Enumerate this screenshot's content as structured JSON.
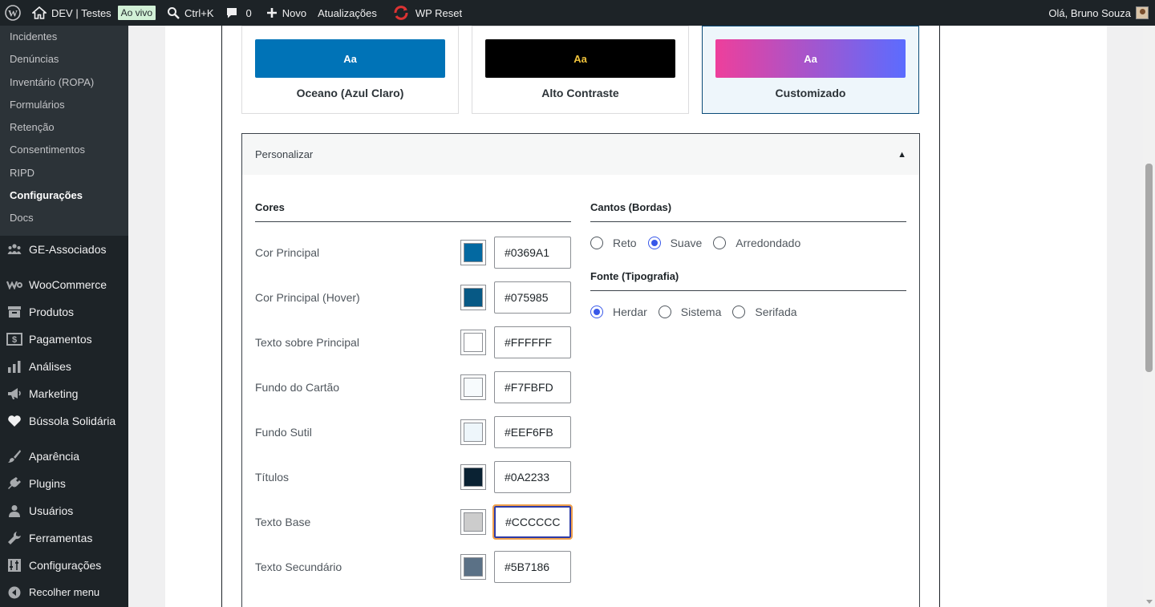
{
  "adminbar": {
    "site_name": "DEV | Testes",
    "live_badge": "Ao vivo",
    "search_shortcut": "Ctrl+K",
    "comments_count": "0",
    "new_label": "Novo",
    "updates_label": "Atualizações",
    "wpreset_label": "WP Reset",
    "greeting": "Olá, Bruno Souza"
  },
  "sidebar": {
    "submenu": [
      "Incidentes",
      "Denúncias",
      "Inventário (ROPA)",
      "Formulários",
      "Retenção",
      "Consentimentos",
      "RIPD",
      "Configurações",
      "Docs"
    ],
    "current_submenu": "Configurações",
    "menu": [
      {
        "label": "GE-Associados",
        "icon": "groups-icon"
      },
      {
        "label": "WooCommerce",
        "icon": "woocommerce-icon"
      },
      {
        "label": "Produtos",
        "icon": "archive-icon"
      },
      {
        "label": "Pagamentos",
        "icon": "money-icon"
      },
      {
        "label": "Análises",
        "icon": "chart-bar-icon"
      },
      {
        "label": "Marketing",
        "icon": "megaphone-icon"
      },
      {
        "label": "Bússola Solidária",
        "icon": "heart-icon"
      },
      {
        "label": "Aparência",
        "icon": "paintbrush-icon"
      },
      {
        "label": "Plugins",
        "icon": "plugin-icon"
      },
      {
        "label": "Usuários",
        "icon": "user-icon"
      },
      {
        "label": "Ferramentas",
        "icon": "wrench-icon"
      },
      {
        "label": "Configurações",
        "icon": "settings-sliders-icon"
      },
      {
        "label": "Recolher menu",
        "icon": "collapse-icon"
      }
    ]
  },
  "themes": [
    {
      "name": "Oceano (Azul Claro)",
      "preview": "Aa",
      "bg": "#0073b7",
      "fg": "#ffffff",
      "selected": false
    },
    {
      "name": "Alto Contraste",
      "preview": "Aa",
      "bg": "#000000",
      "fg": "#f0c33c",
      "selected": false
    },
    {
      "name": "Customizado",
      "preview": "Aa",
      "bg": "linear-gradient(90deg,#ee3f9b,#5b6cff)",
      "fg": "#ffffff",
      "selected": true
    }
  ],
  "accordion": {
    "title": "Personalizar",
    "arrow": "▲"
  },
  "colors": {
    "title": "Cores",
    "rows": [
      {
        "label": "Cor Principal",
        "value": "#0369A1",
        "swatch": "#0369a1"
      },
      {
        "label": "Cor Principal (Hover)",
        "value": "#075985",
        "swatch": "#075985"
      },
      {
        "label": "Texto sobre Principal",
        "value": "#FFFFFF",
        "swatch": "#ffffff"
      },
      {
        "label": "Fundo do Cartão",
        "value": "#F7FBFD",
        "swatch": "#f7fbfd"
      },
      {
        "label": "Fundo Sutil",
        "value": "#EEF6FB",
        "swatch": "#eef6fb"
      },
      {
        "label": "Títulos",
        "value": "#0A2233",
        "swatch": "#0a2233"
      },
      {
        "label": "Texto Base",
        "value": "#CCCCCC",
        "swatch": "#cccccc",
        "focused": true
      },
      {
        "label": "Texto Secundário",
        "value": "#5B7186",
        "swatch": "#5b7186"
      }
    ]
  },
  "corners": {
    "title": "Cantos (Bordas)",
    "options": [
      "Reto",
      "Suave",
      "Arredondado"
    ],
    "selected": "Suave"
  },
  "font": {
    "title": "Fonte (Tipografia)",
    "options": [
      "Herdar",
      "Sistema",
      "Serifada"
    ],
    "selected": "Herdar"
  }
}
